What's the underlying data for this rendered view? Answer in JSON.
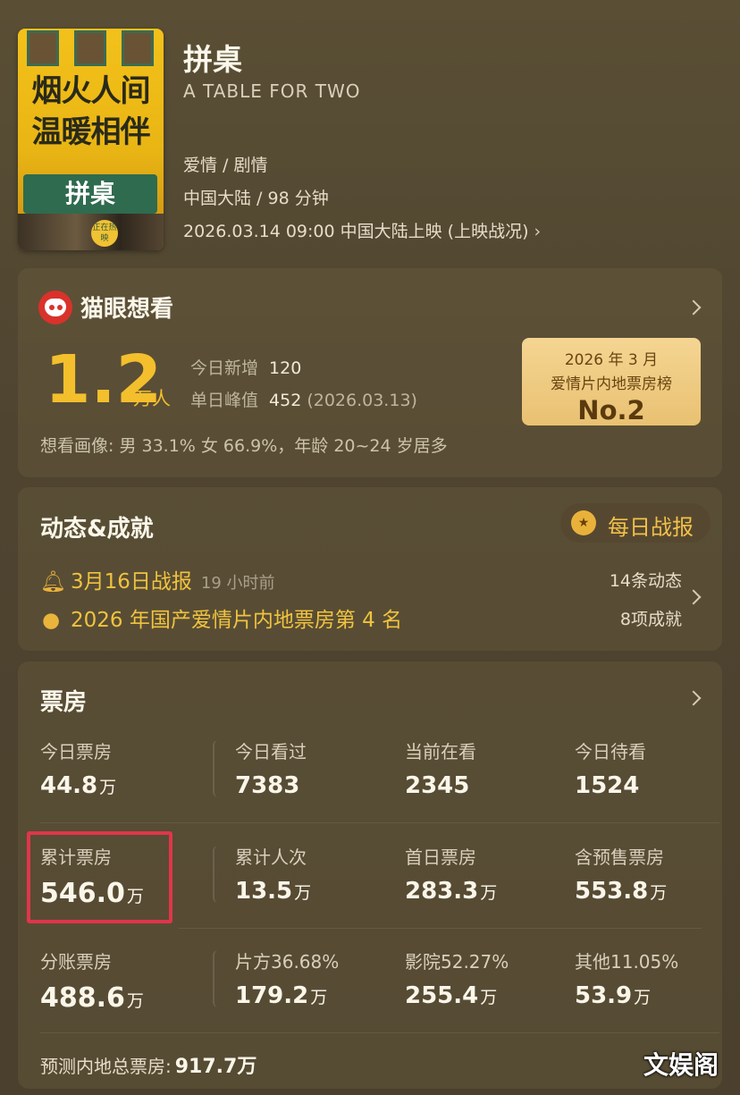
{
  "movie": {
    "title": "拼桌",
    "english_title": "A TABLE FOR TWO",
    "genre": "爱情 / 剧情",
    "region_duration": "中国大陆 / 98 分钟",
    "release": "2026.03.14 09:00 中国大陆上映 (上映战况)",
    "poster": {
      "line1": "烟火人间",
      "line2": "温暖相伴",
      "sign": "拼桌",
      "badge": "正在热映"
    }
  },
  "maoyan": {
    "title": "猫眼想看",
    "total": "1.2",
    "unit": "万人",
    "today_new_label": "今日新增",
    "today_new_value": "120",
    "peak_label": "单日峰值",
    "peak_value": "452",
    "peak_date": "(2026.03.13)",
    "rank": {
      "period": "2026 年 3 月",
      "category": "爱情片内地票房榜",
      "rank": "No.2"
    },
    "profile": "想看画像: 男 33.1%  女 66.9%，年龄 20~24 岁居多"
  },
  "dynamics": {
    "title": "动态&成就",
    "daily_report": "每日战报",
    "items": [
      {
        "text": "3月16日战报",
        "ago": "19 小时前",
        "count": "14条动态"
      },
      {
        "text": "2026 年国产爱情片内地票房第 4 名",
        "count": "8项成就"
      }
    ]
  },
  "boxoffice": {
    "title": "票房",
    "rows": [
      [
        {
          "label": "今日票房",
          "value": "44.8",
          "unit": "万"
        },
        {
          "label": "今日看过",
          "value": "7383",
          "unit": ""
        },
        {
          "label": "当前在看",
          "value": "2345",
          "unit": ""
        },
        {
          "label": "今日待看",
          "value": "1524",
          "unit": ""
        }
      ],
      [
        {
          "label": "累计票房",
          "value": "546.0",
          "unit": "万"
        },
        {
          "label": "累计人次",
          "value": "13.5",
          "unit": "万"
        },
        {
          "label": "首日票房",
          "value": "283.3",
          "unit": "万"
        },
        {
          "label": "含预售票房",
          "value": "553.8",
          "unit": "万"
        }
      ],
      [
        {
          "label": "分账票房",
          "value": "488.6",
          "unit": "万"
        },
        {
          "label": "片方36.68%",
          "value": "179.2",
          "unit": "万"
        },
        {
          "label": "影院52.27%",
          "value": "255.4",
          "unit": "万"
        },
        {
          "label": "其他11.05%",
          "value": "53.9",
          "unit": "万"
        }
      ]
    ],
    "forecast_label": "预测内地总票房:",
    "forecast_value": "917.7万"
  },
  "watermark": "文娱阁",
  "colors": {
    "accent": "#f4bf2c",
    "highlight": "#e0364a",
    "maoyan_red": "#d9322b"
  }
}
